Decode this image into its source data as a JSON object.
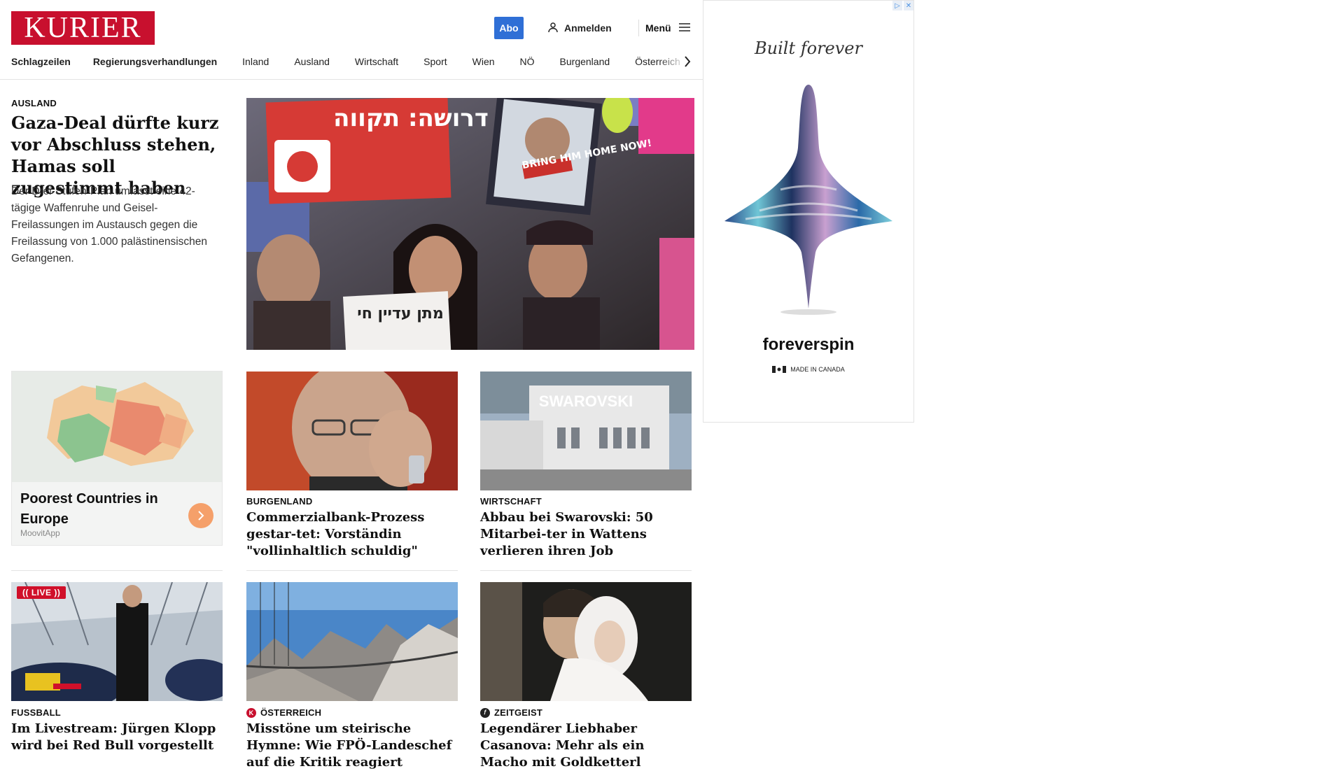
{
  "header": {
    "logo": "KURIER",
    "abo": "Abo",
    "login": "Anmelden",
    "menu": "Menü"
  },
  "nav": {
    "items": [
      "Schlagzeilen",
      "Regierungsverhandlungen",
      "Inland",
      "Ausland",
      "Wirtschaft",
      "Sport",
      "Wien",
      "NÖ",
      "Burgenland",
      "Österreich"
    ]
  },
  "lead": {
    "kicker": "AUSLAND",
    "headline": "Gaza-Deal dürfte kurz vor Abschluss stehen, Hamas soll zugestimmt haben",
    "teaser": "Der Drei-Stufen-Plan umfasst eine 42-tägige Waffenruhe und Geisel-Freilassungen im Austausch gegen die Freilassung von 1.000 palästinensischen Gefangenen.",
    "image_sign_text": "דרושה: תקווה",
    "image_sign2_text": "BRING HIM HOME NOW!",
    "image_sign3_text": "מתן עדיין חי"
  },
  "ad_card": {
    "title": "Poorest Countries in Europe",
    "source": "MoovitApp"
  },
  "articles_row1": [
    {
      "kicker": "BURGENLAND",
      "headline": "Commerzialbank-Prozess gestar-tet: Vorständin \"vollinhaltlich schuldig\""
    },
    {
      "kicker": "WIRTSCHAFT",
      "headline": "Abbau bei Swarovski: 50 Mitarbei-ter in Wattens verlieren ihren Job",
      "image_text": "SWAROVSKI"
    }
  ],
  "articles_row2": [
    {
      "kicker": "FUSSBALL",
      "headline": "Im Livestream: Jürgen Klopp wird bei Red Bull vorgestellt",
      "badge": "(( LIVE ))"
    },
    {
      "kicker": "ÖSTERREICH",
      "headline": "Misstöne um steirische Hymne: Wie FPÖ-Landeschef auf die Kritik reagiert",
      "icon_letter": "K"
    },
    {
      "kicker": "ZEITGEIST",
      "headline": "Legendärer Liebhaber Casanova: Mehr als ein Macho mit Goldketterl",
      "icon_letter": "𝑓"
    }
  ],
  "side_ad": {
    "tagline": "Built forever",
    "brand": "foreverspin",
    "origin": "MADE IN CANADA"
  },
  "colors": {
    "brand": "#c8102e",
    "abo": "#2f6fd6",
    "live": "#d0102a",
    "cta": "#f5a06a"
  }
}
